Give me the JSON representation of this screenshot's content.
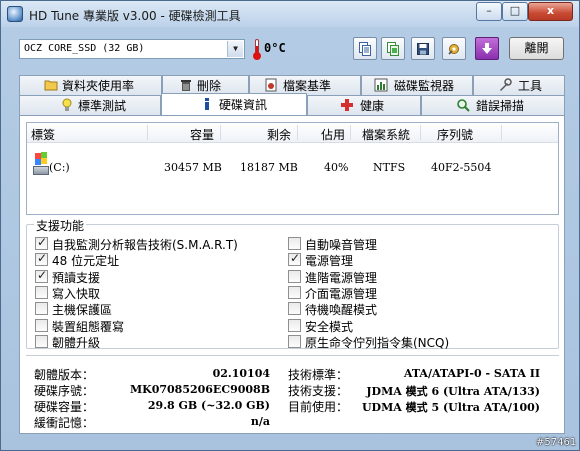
{
  "window": {
    "title": "HD Tune 專業版 v3.00 - 硬碟檢測工具",
    "controls": {
      "minimize": "–",
      "maximize": "□",
      "close": "x"
    }
  },
  "toolbar": {
    "device": "OCZ CORE_SSD (32 GB)",
    "temperature": "0°C",
    "exit_label": "離開"
  },
  "tabs_top": [
    {
      "label": "資料夾使用率",
      "icon": "folder-usage-icon"
    },
    {
      "label": "刪除",
      "icon": "delete-icon"
    },
    {
      "label": "檔案基準",
      "icon": "file-benchmark-icon"
    },
    {
      "label": "磁碟監視器",
      "icon": "disk-monitor-icon"
    },
    {
      "label": "工具",
      "icon": "tools-icon"
    }
  ],
  "tabs_bottom": [
    {
      "label": "標準測試",
      "icon": "benchmark-icon"
    },
    {
      "label": "硬碟資訊",
      "icon": "info-icon",
      "active": true
    },
    {
      "label": "健康",
      "icon": "health-icon"
    },
    {
      "label": "錯誤掃描",
      "icon": "error-scan-icon"
    }
  ],
  "partitions": {
    "headers": [
      "標簽",
      "容量",
      "剩余",
      "佔用",
      "檔案系統",
      "序列號"
    ],
    "rows": [
      {
        "label": "(C:)",
        "capacity": "30457 MB",
        "free": "18187 MB",
        "usage": "40%",
        "fs": "NTFS",
        "serial": "40F2-5504"
      }
    ]
  },
  "features": {
    "title": "支援功能",
    "left": [
      {
        "label": "自我監測分析報告技術(S.M.A.R.T)",
        "checked": true
      },
      {
        "label": "48 位元定址",
        "checked": true
      },
      {
        "label": "預讀支援",
        "checked": true
      },
      {
        "label": "寫入快取",
        "checked": false
      },
      {
        "label": "主機保護區",
        "checked": false
      },
      {
        "label": "裝置組態覆寫",
        "checked": false
      },
      {
        "label": "韌體升級",
        "checked": false
      }
    ],
    "right": [
      {
        "label": "自動噪音管理",
        "checked": false
      },
      {
        "label": "電源管理",
        "checked": true
      },
      {
        "label": "進階電源管理",
        "checked": false
      },
      {
        "label": "介面電源管理",
        "checked": false
      },
      {
        "label": "待機喚醒模式",
        "checked": false
      },
      {
        "label": "安全模式",
        "checked": false
      },
      {
        "label": "原生命令佇列指令集(NCQ)",
        "checked": false
      }
    ]
  },
  "info": {
    "firmware_label": "韌體版本：",
    "firmware": "02.10104",
    "serial_label": "硬碟序號：",
    "serial": "MK07085206EC9008B",
    "capacity_label": "硬碟容量：",
    "capacity": "29.8 GB (~32.0 GB)",
    "cache_label": "緩衝記憶：",
    "cache": "n/a",
    "standard_label": "技術標準：",
    "standard": "ATA/ATAPI-0 - SATA II",
    "supported_label": "技術支援：",
    "supported": "JDMA 模式 6 (Ultra ATA/133)",
    "current_label": "目前使用：",
    "current": "UDMA 模式 5 (Ultra ATA/100)"
  },
  "watermark": "#57461",
  "colors": {
    "accent": "#2b5f97",
    "close": "#c94a33"
  }
}
